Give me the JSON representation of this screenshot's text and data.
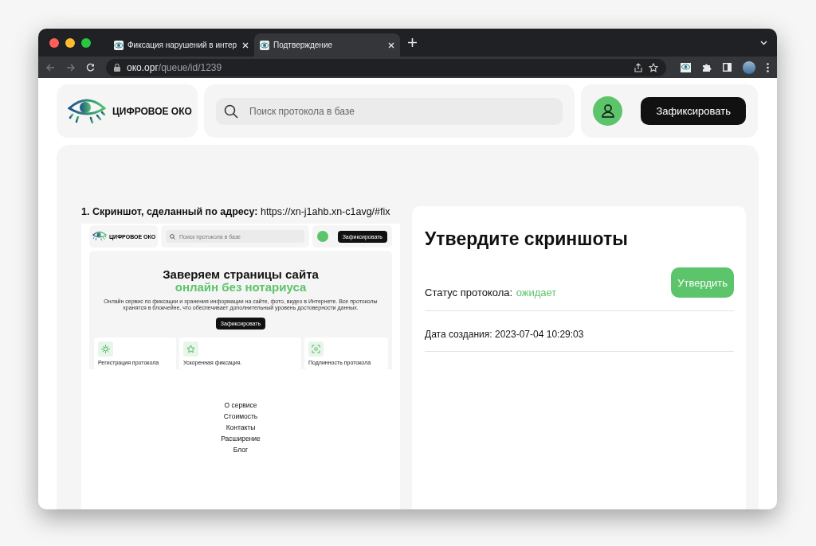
{
  "browser": {
    "tabs": [
      {
        "title": "Фиксация нарушений в интер",
        "selected": false
      },
      {
        "title": "Подтверждение",
        "selected": true
      }
    ],
    "url_host": "око.орг",
    "url_path": "/queue/id/1239"
  },
  "header": {
    "logo_text": "ЦИФРОВОЕ ОКО",
    "search": {
      "placeholder": "Поиск протокола в базе"
    },
    "action_button": "Зафиксировать"
  },
  "screenshot": {
    "caption": "**1. Скриншот, сделанный по адресу:** https://xn-j1ahb.xn-c1avg/#fix",
    "preview": {
      "logo_text": "ЦИФРОВОЕ ОКО",
      "search_placeholder": "Поиск протокола в базе",
      "action_button": "Зафиксировать",
      "headline": "Заверяем страницы сайта",
      "headline_accent": "онлайн без нотариуса",
      "description": "Онлайн сервис по фиксации и хранения информации на сайте, фото, видео в Интернете. Все протоколы хранятся в блокчейне, что обеспечивает дополнительный уровень достоверности данных.",
      "hero_button": "Зафиксировать",
      "features": [
        {
          "kind": "network",
          "title": "Регистрация протокола"
        },
        {
          "kind": "star",
          "title": "Ускоренная фиксация."
        },
        {
          "kind": "scan",
          "title": "Подлинность протокола"
        }
      ]
    },
    "footer_links": [
      "О сервисе",
      "Стоимость",
      "Контакты",
      "Расширение",
      "Блог"
    ]
  },
  "confirm_panel": {
    "title": "Утвердите скриншоты",
    "status_label": "Статус протокола:",
    "status_value": "ожидает",
    "approve_button": "Утвердить",
    "created": "Дата создания: 2023-07-04 10:29:03"
  }
}
